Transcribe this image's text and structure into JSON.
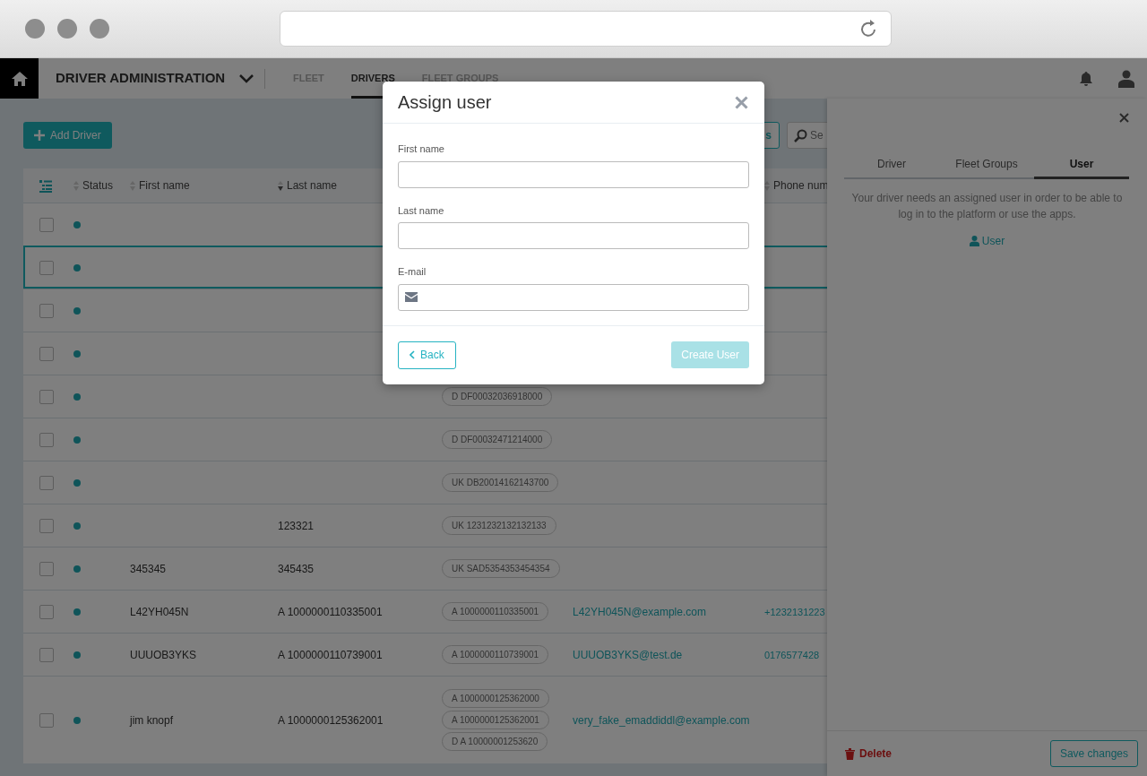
{
  "header": {
    "title": "DRIVER ADMINISTRATION",
    "tabs": [
      {
        "label": "FLEET",
        "selected": false
      },
      {
        "label": "DRIVERS",
        "selected": true
      },
      {
        "label": "FLEET GROUPS",
        "selected": false
      }
    ]
  },
  "toolbar": {
    "add_button": "Add Driver",
    "partial_button": "s",
    "search": {
      "placeholder": "Se"
    }
  },
  "table": {
    "columns": [
      {
        "label": "Status",
        "sorted": false
      },
      {
        "label": "First name",
        "sorted": false
      },
      {
        "label": "Last name",
        "sorted": true
      },
      {
        "label": "Phone num",
        "sorted": false
      }
    ],
    "rows": [
      {
        "selected": false
      },
      {
        "selected": true
      },
      {
        "selected": false
      },
      {
        "selected": false
      },
      {
        "selected": false,
        "cards": [
          "D DF00032036918000"
        ]
      },
      {
        "selected": false,
        "cards": [
          "D DF00032471214000"
        ]
      },
      {
        "selected": false,
        "cards": [
          "UK DB20014162143700"
        ]
      },
      {
        "selected": false,
        "last_name": "123321",
        "cards": [
          "UK 1231232132132133"
        ]
      },
      {
        "selected": false,
        "first_name": "345345",
        "last_name": "345435",
        "cards": [
          "UK SAD5354353454354"
        ]
      },
      {
        "selected": false,
        "first_name": "L42YH045N",
        "last_name": "A 1000000110335001",
        "cards": [
          "A 1000000110335001"
        ],
        "email": "L42YH045N@example.com",
        "phone": "+1232131223"
      },
      {
        "selected": false,
        "first_name": "UUUOB3YKS",
        "last_name": "A 1000000110739001",
        "cards": [
          "A 1000000110739001"
        ],
        "email": "UUUOB3YKS@test.de",
        "phone": "0176577428"
      },
      {
        "selected": false,
        "first_name": "jim knopf",
        "last_name": "A 1000000125362001",
        "cards": [
          "A 1000000125362000",
          "A 1000000125362001",
          "D A 10000001253620"
        ],
        "email": "very_fake_emaddiddl@example.com"
      }
    ]
  },
  "side_panel": {
    "tabs": [
      {
        "label": "Driver",
        "selected": false
      },
      {
        "label": "Fleet Groups",
        "selected": false
      },
      {
        "label": "User",
        "selected": true
      }
    ],
    "message": "Your driver needs an assigned user in order to be able to log in to the platform or use the apps.",
    "user_link": "User",
    "delete": "Delete",
    "save": "Save changes"
  },
  "dialog": {
    "title": "Assign user",
    "fields": [
      {
        "label": "First name",
        "kind": "text"
      },
      {
        "label": "Last name",
        "kind": "text"
      },
      {
        "label": "E-mail",
        "kind": "email"
      }
    ],
    "back": "Back",
    "create": {
      "label": "Create User",
      "disabled": true
    }
  }
}
